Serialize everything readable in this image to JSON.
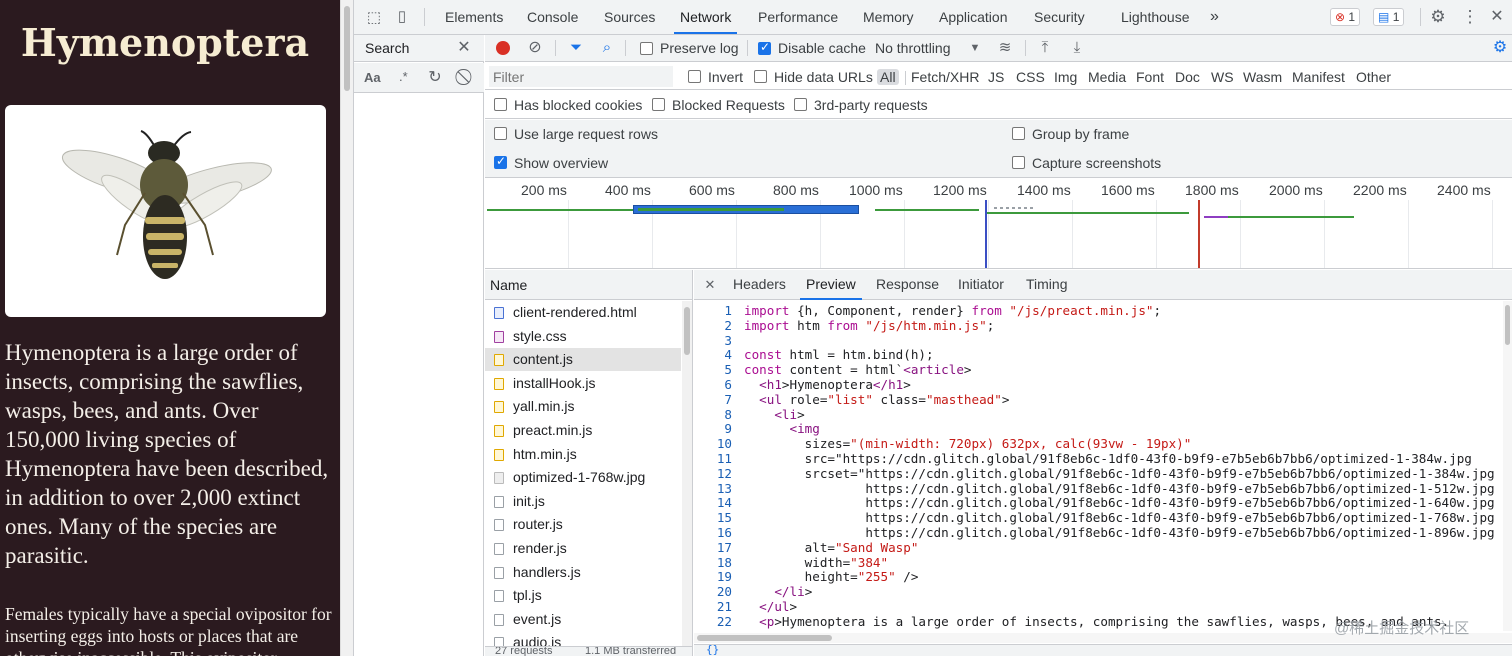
{
  "page": {
    "title": "Hymenoptera",
    "paragraph1": "Hymenoptera is a large order of insects, comprising the sawflies, wasps, bees, and ants. Over 150,000 living species of Hymenoptera have been described, in addition to over 2,000 extinct ones. Many of the species are parasitic.",
    "paragraph2": "Females typically have a special ovipositor for inserting eggs into hosts or places that are otherwise inaccessible. This ovipositor"
  },
  "devtools": {
    "tabs": [
      "Elements",
      "Console",
      "Sources",
      "Network",
      "Performance",
      "Memory",
      "Application",
      "Security",
      "Lighthouse"
    ],
    "active_tab": "Network",
    "more_tabs": "»",
    "errors_count": "1",
    "messages_count": "1",
    "search": {
      "title": "Search",
      "aa": "Aa",
      "regex": ".*"
    },
    "toolbar": {
      "preserve_log": "Preserve log",
      "disable_cache": "Disable cache",
      "throttling": "No throttling"
    },
    "filter": {
      "placeholder": "Filter",
      "invert": "Invert",
      "hide_data_urls": "Hide data URLs",
      "types": [
        "All",
        "Fetch/XHR",
        "JS",
        "CSS",
        "Img",
        "Media",
        "Font",
        "Doc",
        "WS",
        "Wasm",
        "Manifest",
        "Other"
      ],
      "has_blocked_cookies": "Has blocked cookies",
      "blocked_requests": "Blocked Requests",
      "third_party": "3rd-party requests"
    },
    "settings": {
      "large_rows": "Use large request rows",
      "group_by_frame": "Group by frame",
      "show_overview": "Show overview",
      "capture_screenshots": "Capture screenshots"
    },
    "overview_ticks": [
      "200 ms",
      "400 ms",
      "600 ms",
      "800 ms",
      "1000 ms",
      "1200 ms",
      "1400 ms",
      "1600 ms",
      "1800 ms",
      "2000 ms",
      "2200 ms",
      "2400 ms"
    ],
    "name_header": "Name",
    "requests": [
      {
        "name": "client-rendered.html",
        "type": "html"
      },
      {
        "name": "style.css",
        "type": "css"
      },
      {
        "name": "content.js",
        "type": "js"
      },
      {
        "name": "installHook.js",
        "type": "js"
      },
      {
        "name": "yall.min.js",
        "type": "js"
      },
      {
        "name": "preact.min.js",
        "type": "js"
      },
      {
        "name": "htm.min.js",
        "type": "js"
      },
      {
        "name": "optimized-1-768w.jpg",
        "type": "img"
      },
      {
        "name": "init.js",
        "type": "doc"
      },
      {
        "name": "router.js",
        "type": "doc"
      },
      {
        "name": "render.js",
        "type": "doc"
      },
      {
        "name": "handlers.js",
        "type": "doc"
      },
      {
        "name": "tpl.js",
        "type": "doc"
      },
      {
        "name": "event.js",
        "type": "doc"
      },
      {
        "name": "audio.js",
        "type": "doc"
      }
    ],
    "selected_request": "content.js",
    "detail_tabs": [
      "Headers",
      "Preview",
      "Response",
      "Initiator",
      "Timing"
    ],
    "active_detail_tab": "Preview",
    "code_lines": [
      "import {h, Component, render} from \"/js/preact.min.js\";",
      "import htm from \"/js/htm.min.js\";",
      "",
      "const html = htm.bind(h);",
      "const content = html`<article>",
      "  <h1>Hymenoptera</h1>",
      "  <ul role=\"list\" class=\"masthead\">",
      "    <li>",
      "      <img",
      "        sizes=\"(min-width: 720px) 632px, calc(93vw - 19px)\"",
      "        src=\"https://cdn.glitch.global/91f8eb6c-1df0-43f0-b9f9-e7b5eb6b7bb6/optimized-1-384w.jpg",
      "        srcset=\"https://cdn.glitch.global/91f8eb6c-1df0-43f0-b9f9-e7b5eb6b7bb6/optimized-1-384w.jpg",
      "                https://cdn.glitch.global/91f8eb6c-1df0-43f0-b9f9-e7b5eb6b7bb6/optimized-1-512w.jpg",
      "                https://cdn.glitch.global/91f8eb6c-1df0-43f0-b9f9-e7b5eb6b7bb6/optimized-1-640w.jpg",
      "                https://cdn.glitch.global/91f8eb6c-1df0-43f0-b9f9-e7b5eb6b7bb6/optimized-1-768w.jpg",
      "                https://cdn.glitch.global/91f8eb6c-1df0-43f0-b9f9-e7b5eb6b7bb6/optimized-1-896w.jpg",
      "        alt=\"Sand Wasp\"",
      "        width=\"384\"",
      "        height=\"255\" />",
      "    </li>",
      "  </ul>",
      "  <p>Hymenoptera is a large order of insects, comprising the sawflies, wasps, bees, and ants."
    ],
    "watermark": "@稀土掘金技术社区",
    "status": {
      "requests": "27 requests",
      "transferred": "1.1 MB transferred"
    }
  },
  "colors": {
    "page_bg": "#2b1a1f",
    "accent": "#1a73e8",
    "record": "#d93025"
  }
}
